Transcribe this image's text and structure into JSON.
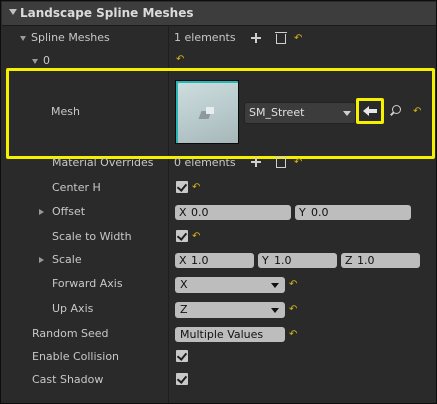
{
  "header": {
    "title": "Landscape Spline Meshes"
  },
  "spline_meshes": {
    "label": "Spline Meshes",
    "count": "1 elements",
    "index": "0"
  },
  "mesh": {
    "label": "Mesh",
    "asset": "SM_Street"
  },
  "material_overrides": {
    "label": "Material Overrides",
    "count": "0 elements"
  },
  "center_h": {
    "label": "Center H",
    "checked": true
  },
  "offset": {
    "label": "Offset",
    "x_axis": "X",
    "x_val": "0.0",
    "y_axis": "Y",
    "y_val": "0.0"
  },
  "scale_to_width": {
    "label": "Scale to Width",
    "checked": true
  },
  "scale": {
    "label": "Scale",
    "x_axis": "X",
    "x_val": "1.0",
    "y_axis": "Y",
    "y_val": "1.0",
    "z_axis": "Z",
    "z_val": "1.0"
  },
  "forward_axis": {
    "label": "Forward Axis",
    "value": "X"
  },
  "up_axis": {
    "label": "Up Axis",
    "value": "Z"
  },
  "random_seed": {
    "label": "Random Seed",
    "value": "Multiple Values"
  },
  "enable_collision": {
    "label": "Enable Collision",
    "checked": true
  },
  "cast_shadow": {
    "label": "Cast Shadow",
    "checked": true
  },
  "colors": {
    "highlight": "#f5f000",
    "reset_arrow": "#d6b218",
    "thumbnail_border": "#27b6b6"
  },
  "icons": {
    "reset": "↶"
  }
}
